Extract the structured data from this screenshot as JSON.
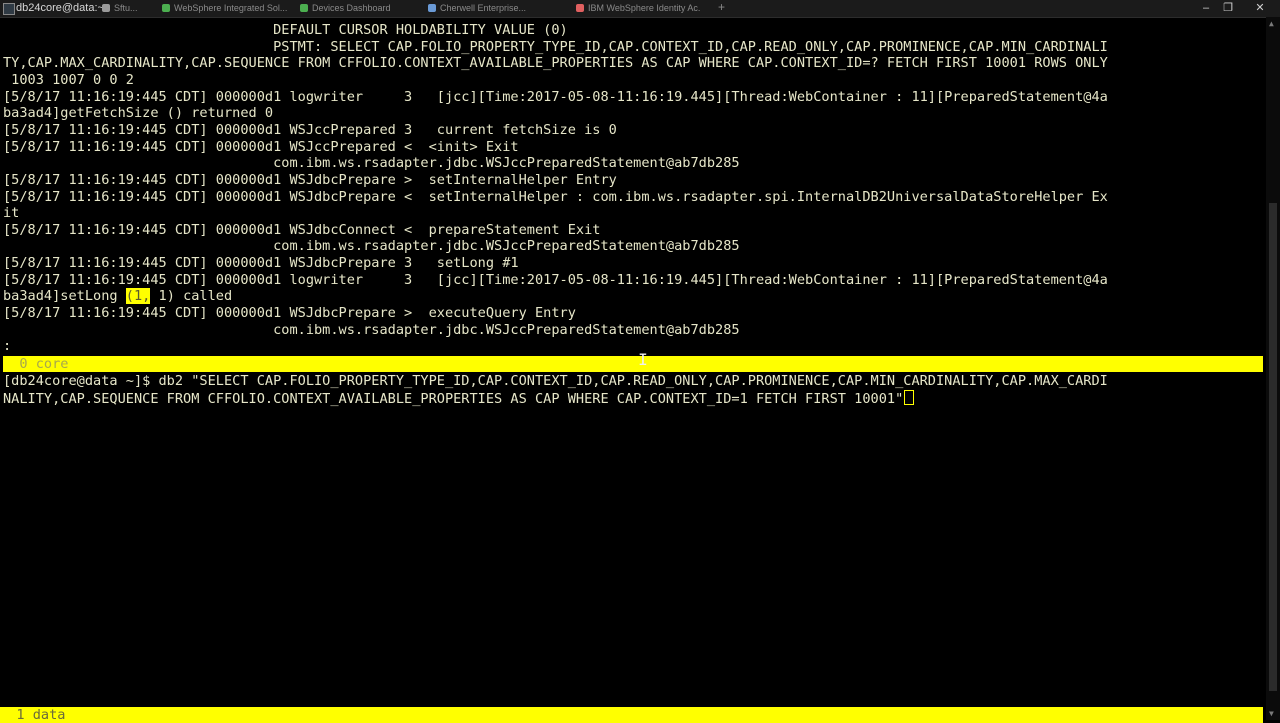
{
  "window": {
    "title": "db24core@data:~",
    "tabs": [
      {
        "label": "Sftu...",
        "color": "#9a9a9a"
      },
      {
        "label": "WebSphere Integrated Sol...",
        "color": "#4caf50"
      },
      {
        "label": "Devices Dashboard",
        "color": "#4caf50"
      },
      {
        "label": "Cherwell Enterprise...",
        "color": "#6a9ad6"
      },
      {
        "label": "IBM WebSphere Identity Ac...",
        "color": "#e06060"
      }
    ],
    "new_tab_symbol": "+",
    "minimize_symbol": "–",
    "restore_symbol": "❐",
    "close_symbol": "✕"
  },
  "colors": {
    "terminal_background": "#000000",
    "terminal_text": "#e6e6c8",
    "status_bar": "#ffff00"
  },
  "terminal": {
    "lines": [
      "                                 DEFAULT CURSOR HOLDABILITY VALUE (0)",
      "                                 PSTMT: SELECT CAP.FOLIO_PROPERTY_TYPE_ID,CAP.CONTEXT_ID,CAP.READ_ONLY,CAP.PROMINENCE,CAP.MIN_CARDINALI",
      "TY,CAP.MAX_CARDINALITY,CAP.SEQUENCE FROM CFFOLIO.CONTEXT_AVAILABLE_PROPERTIES AS CAP WHERE CAP.CONTEXT_ID=? FETCH FIRST 10001 ROWS ONLY",
      " 1003 1007 0 0 2",
      "[5/8/17 11:16:19:445 CDT] 000000d1 logwriter     3   [jcc][Time:2017-05-08-11:16:19.445][Thread:WebContainer : 11][PreparedStatement@4a",
      "ba3ad4]getFetchSize () returned 0",
      "[5/8/17 11:16:19:445 CDT] 000000d1 WSJccPrepared 3   current fetchSize is 0",
      "[5/8/17 11:16:19:445 CDT] 000000d1 WSJccPrepared <  <init> Exit",
      "                                 com.ibm.ws.rsadapter.jdbc.WSJccPreparedStatement@ab7db285",
      "[5/8/17 11:16:19:445 CDT] 000000d1 WSJdbcPrepare >  setInternalHelper Entry",
      "[5/8/17 11:16:19:445 CDT] 000000d1 WSJdbcPrepare <  setInternalHelper : com.ibm.ws.rsadapter.spi.InternalDB2UniversalDataStoreHelper Ex",
      "it",
      "[5/8/17 11:16:19:445 CDT] 000000d1 WSJdbcConnect <  prepareStatement Exit",
      "                                 com.ibm.ws.rsadapter.jdbc.WSJccPreparedStatement@ab7db285",
      "[5/8/17 11:16:19:445 CDT] 000000d1 WSJdbcPrepare 3   setLong #1",
      "[5/8/17 11:16:19:445 CDT] 000000d1 logwriter     3   [jcc][Time:2017-05-08-11:16:19.445][Thread:WebContainer : 11][PreparedStatement@4a"
    ],
    "setlong_prefix": "ba3ad4]setLong ",
    "setlong_highlight": "(1,",
    "setlong_suffix": " 1) called",
    "lines_after": [
      "[5/8/17 11:16:19:445 CDT] 000000d1 WSJdbcPrepare >  executeQuery Entry",
      "                                 com.ibm.ws.rsadapter.jdbc.WSJccPreparedStatement@ab7db285",
      ":"
    ],
    "status_top": "  0 core",
    "prompt_line_1": "[db24core@data ~]$ db2 \"SELECT CAP.FOLIO_PROPERTY_TYPE_ID,CAP.CONTEXT_ID,CAP.READ_ONLY,CAP.PROMINENCE,CAP.MIN_CARDINALITY,CAP.MAX_CARDI",
    "prompt_line_2": "NALITY,CAP.SEQUENCE FROM CFFOLIO.CONTEXT_AVAILABLE_PROPERTIES AS CAP WHERE CAP.CONTEXT_ID=1 FETCH FIRST 10001\"",
    "status_bottom": "  1 data"
  }
}
